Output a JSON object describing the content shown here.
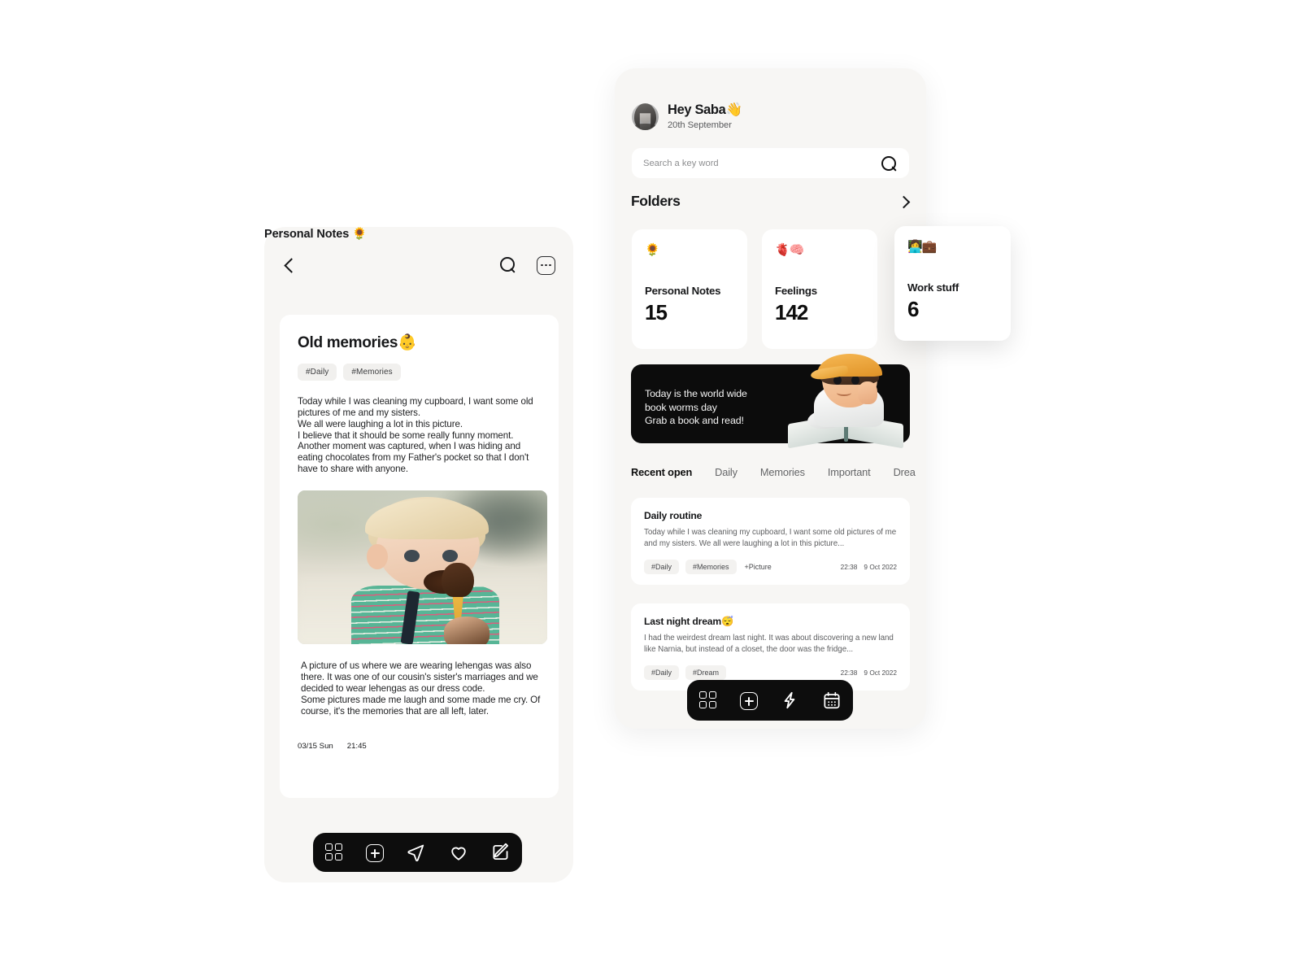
{
  "left_phone": {
    "topbar": {
      "back_icon": "chevron-left-icon",
      "search_icon": "search-icon",
      "more_icon": "more-options-icon"
    },
    "page_title": "Personal Notes 🌻",
    "note": {
      "title": "Old memories👶",
      "tags": [
        "#Daily",
        "#Memories"
      ],
      "body_top": "Today while I was cleaning my cupboard, I want some old pictures of me and my sisters.\nWe all were laughing a lot in this picture.\nI believe that it should be some really funny moment.\nAnother moment was captured, when I was hiding and eating chocolates from my Father's pocket so that I don't have to share with anyone.",
      "photo_alt": "toddler eating chocolate ice cream cone",
      "body_bottom": "A picture of us where we are wearing lehengas was also there. It was one of our cousin's sister's marriages and we decided to wear lehengas as our dress code.\nSome pictures made me laugh and some made me cry. Of course, it's the memories that are all left, later.",
      "date": "03/15 Sun",
      "time": "21:45"
    },
    "nav": [
      {
        "name": "grid-icon",
        "label": "Dashboard"
      },
      {
        "name": "plus-square-icon",
        "label": "New note"
      },
      {
        "name": "send-icon",
        "label": "Share"
      },
      {
        "name": "heart-icon",
        "label": "Favourites"
      },
      {
        "name": "edit-pencil-icon",
        "label": "Edit"
      }
    ]
  },
  "right_phone": {
    "greeting": "Hey Saba👋",
    "date": "20th September",
    "search": {
      "value": "",
      "placeholder": "Search a key word",
      "icon": "search-icon"
    },
    "folders_header": {
      "title": "Folders",
      "chevron": "chevron-right-icon"
    },
    "folders": [
      {
        "emoji": "🌻",
        "label": "Personal Notes",
        "count": "15"
      },
      {
        "emoji": "🫀🧠",
        "label": "Feelings",
        "count": "142"
      },
      {
        "emoji": "👩‍💻💼",
        "label": "Work stuff",
        "count": "6"
      }
    ],
    "banner": {
      "text": "Today is the world wide\nbook worms day\nGrab a book and read!",
      "art": "boy-reading-book-illustration",
      "bg_color": "#0c0c0c"
    },
    "tabs": [
      {
        "label": "Recent open",
        "active": true
      },
      {
        "label": "Daily",
        "active": false
      },
      {
        "label": "Memories",
        "active": false
      },
      {
        "label": "Important",
        "active": false
      },
      {
        "label": "Drea",
        "active": false
      }
    ],
    "recent_notes": [
      {
        "title": "Daily routine",
        "snippet": "Today while I was cleaning my cupboard, I want some old pictures of me and my sisters. We all were laughing a lot in this picture...",
        "tags": [
          "#Daily",
          "#Memories"
        ],
        "extra": "+Picture",
        "time": "22:38",
        "date": "9 Oct 2022"
      },
      {
        "title": "Last night dream😴",
        "snippet": "I had the weirdest dream last night. It was about discovering a new land like Narnia, but instead of a closet, the door was the fridge...",
        "tags": [
          "#Daily",
          "#Dream"
        ],
        "extra": "",
        "time": "22:38",
        "date": "9 Oct 2022"
      }
    ],
    "nav": [
      {
        "name": "grid-icon",
        "label": "Dashboard"
      },
      {
        "name": "plus-square-icon",
        "label": "New note"
      },
      {
        "name": "bolt-icon",
        "label": "Quick"
      },
      {
        "name": "calendar-icon",
        "label": "Calendar"
      }
    ]
  }
}
